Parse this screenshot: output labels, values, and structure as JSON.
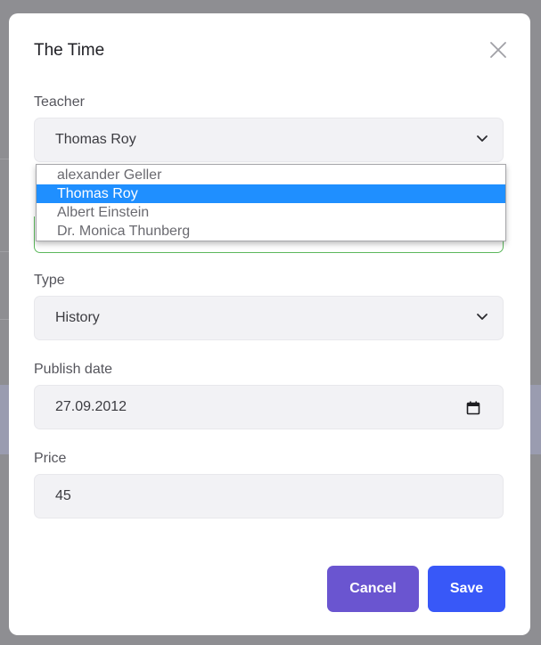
{
  "modal": {
    "title": "The Time"
  },
  "teacher": {
    "label": "Teacher",
    "selected": "Thomas Roy",
    "options": [
      "alexander Geller",
      "Thomas Roy",
      "Albert Einstein",
      "Dr. Monica Thunberg"
    ]
  },
  "type": {
    "label": "Type",
    "value": "History"
  },
  "publish_date": {
    "label": "Publish date",
    "value": "27.09.2012"
  },
  "price": {
    "label": "Price",
    "value": "45"
  },
  "buttons": {
    "cancel": "Cancel",
    "save": "Save"
  },
  "colors": {
    "cancel_button": "#6a55d0",
    "save_button": "#3858f8",
    "selected_option": "#1f8fff",
    "valid_border": "#5cb85c"
  }
}
